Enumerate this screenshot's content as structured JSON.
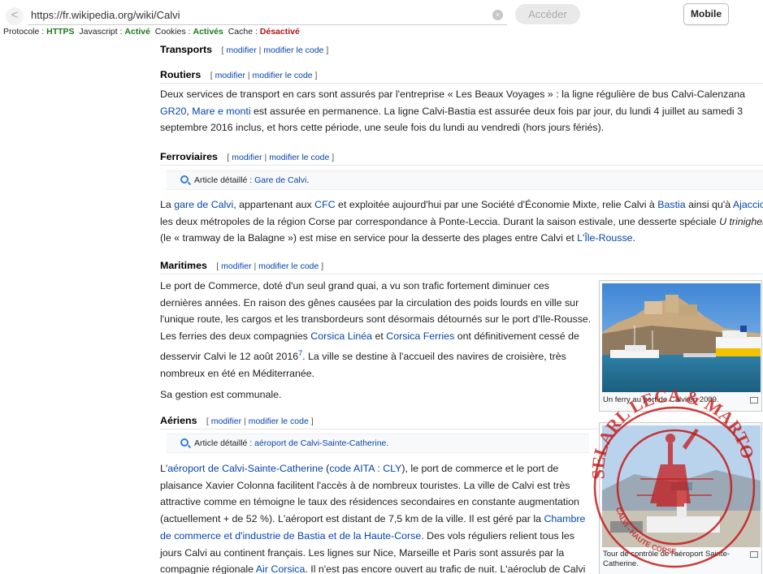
{
  "browser": {
    "url": "https://fr.wikipedia.org/wiki/Calvi",
    "go_label": "Accéder",
    "mobile_label": "Mobile",
    "back_glyph": "<",
    "clear_glyph": "×"
  },
  "status": {
    "protocol_label": "Protocole :",
    "protocol_value": "HTTPS",
    "javascript_label": "Javascript :",
    "javascript_value": "Activé",
    "cookies_label": "Cookies :",
    "cookies_value": "Activés",
    "cache_label": "Cache :",
    "cache_value": "Désactivé"
  },
  "article": {
    "edit_open": "[",
    "edit_modifier": "modifier",
    "edit_sep": "|",
    "edit_modifier_code": "modifier le code",
    "edit_close": "]",
    "transports": {
      "heading": "Transports"
    },
    "routiers": {
      "heading": "Routiers",
      "p1_l1": "Deux services de transport en cars sont assurés par l'entreprise « Les Beaux Voyages » : la ligne régulière de bus Calvi-Calenzana",
      "p1_l2_link1": "GR20",
      "p1_l2_sep": ", ",
      "p1_l2_link2": "Mare e monti",
      "p1_l2_rest": " est assurée en permanence. La ligne Calvi-Bastia est assurée deux fois par jour, du lundi 4 juillet au samedi 3",
      "p1_l3": "septembre 2016 inclus, et hors cette période, une seule fois du lundi au vendredi (hors jours fériés)."
    },
    "ferroviaires": {
      "heading": "Ferroviaires",
      "detail_label": "Article détaillé : ",
      "detail_link": "Gare de Calvi",
      "detail_end": ".",
      "l1_a": "La ",
      "l1_link1": "gare de Calvi",
      "l1_b": ", appartenant aux ",
      "l1_link2": "CFC",
      "l1_c": " et exploitée aujourd'hui par une Société d'Économie Mixte, relie Calvi à ",
      "l1_link3": "Bastia",
      "l1_d": " ainsi qu'à ",
      "l1_link4": "Ajaccio",
      "l1_e": ",",
      "l2_a": "les deux métropoles de la région Corse par correspondance à Ponte-Leccia. Durant la saison estivale, une desserte spéciale ",
      "l2_italic": "U trinighellu",
      "l3_a": "(le « tramway de la Balagne ») est mise en service pour la desserte des plages entre Calvi et ",
      "l3_link": "L'Île-Rousse",
      "l3_end": "."
    },
    "maritimes": {
      "heading": "Maritimes",
      "l1": "Le port de Commerce, doté d'un seul grand quai, a vu son trafic fortement diminuer ces",
      "l2": "dernières années. En raison des gênes causées par la circulation des poids lourds en ville sur",
      "l3": "l'unique route, les cargos et les transbordeurs sont désormais détournés sur le port d'Ile-Rousse.",
      "l4_a": "Les ferries des deux compagnies ",
      "l4_link1": "Corsica Linéa",
      "l4_b": " et ",
      "l4_link2": "Corsica Ferries",
      "l4_c": " ont définitivement cessé de",
      "l5_a": "desservir Calvi le 12 août 2016",
      "l5_sup": "7",
      "l5_b": ". La ville se destine à l'accueil des navires de croisière, très",
      "l6": "nombreux en été en Méditerranée.",
      "l7": "Sa gestion est communale.",
      "thumb_caption": "Un ferry au port de Calvi en 2009."
    },
    "aeriens": {
      "heading": "Aériens",
      "detail_label": "Article détaillé : ",
      "detail_link": "aéroport de Calvi-Sainte-Catherine",
      "detail_end": ".",
      "l1_a": "L'",
      "l1_link1": "aéroport de Calvi-Sainte-Catherine",
      "l1_b": " (",
      "l1_link2": "code AITA : CLY",
      "l1_c": "), le port de commerce et le port de",
      "l2": "plaisance Xavier Colonna facilitent l'accès à de nombreux touristes. La ville de Calvi est très",
      "l3": "attractive comme en témoigne le taux des résidences secondaires en constante augmentation",
      "l4_a": "(actuellement + de 52 %). L'aéroport est distant de 7,5 km de la ville. Il est géré par la ",
      "l4_link": "Chambre",
      "l5_link": "de commerce et d'industrie de Bastia et de la Haute-Corse",
      "l5_b": ". Des vols réguliers relient tous les",
      "l6": "jours Calvi au continent français. Les lignes sur Nice, Marseille et Paris sont assurés par la",
      "l7_a": "compagnie régionale ",
      "l7_link": "Air Corsica",
      "l7_b": ". Il n'est pas encore ouvert au trafic de nuit. L'aéroclub de Calvi",
      "thumb_caption_1": "Tour de contrôle de l'aéroport Sainte-",
      "thumb_caption_2": "Catherine."
    }
  },
  "stamp": {
    "text_top": "SELARL LECA & MARTOCCHI Huissiers Associés",
    "text_bottom": "CALVI - HAUTE CORSE",
    "color": "#c41a1a"
  }
}
